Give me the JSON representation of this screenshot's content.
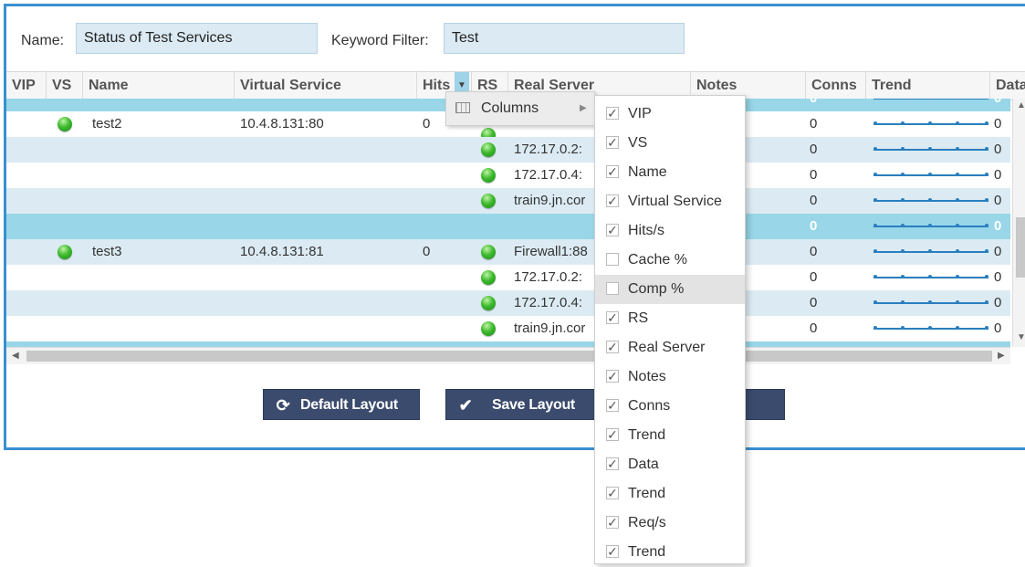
{
  "filter": {
    "name_label": "Name:",
    "name_value": "Status of Test Services",
    "keyword_label": "Keyword Filter:",
    "keyword_value": "Test"
  },
  "columns": [
    "VIP",
    "VS",
    "Name",
    "Virtual Service",
    "Hits",
    "RS",
    "Real Server",
    "Notes",
    "Conns",
    "Trend",
    "Data"
  ],
  "rows": [
    {
      "name": "",
      "vs": "",
      "hits": "",
      "rs": "",
      "real_server": "",
      "conns": "0",
      "data": "0"
    },
    {
      "name": "test2",
      "vs": "10.4.8.131:80",
      "hits": "0",
      "rs": "",
      "real_server": "",
      "conns": "0",
      "data": "0"
    },
    {
      "name": "",
      "vs": "",
      "hits": "",
      "rs": "",
      "real_server": "172.17.0.2:",
      "conns": "0",
      "data": "0"
    },
    {
      "name": "",
      "vs": "",
      "hits": "",
      "rs": "",
      "real_server": "172.17.0.4:",
      "conns": "0",
      "data": "0"
    },
    {
      "name": "",
      "vs": "",
      "hits": "",
      "rs": "",
      "real_server": "train9.jn.cor",
      "conns": "0",
      "data": "0"
    },
    {
      "name": "",
      "vs": "",
      "hits": "",
      "rs": "",
      "real_server": "",
      "conns": "0",
      "data": "0"
    },
    {
      "name": "test3",
      "vs": "10.4.8.131:81",
      "hits": "0",
      "rs": "",
      "real_server": "Firewall1:88",
      "conns": "0",
      "data": "0"
    },
    {
      "name": "",
      "vs": "",
      "hits": "",
      "rs": "",
      "real_server": "172.17.0.2:",
      "conns": "0",
      "data": "0"
    },
    {
      "name": "",
      "vs": "",
      "hits": "",
      "rs": "",
      "real_server": "172.17.0.4:",
      "conns": "0",
      "data": "0"
    },
    {
      "name": "",
      "vs": "",
      "hits": "",
      "rs": "",
      "real_server": "train9.jn.cor",
      "conns": "0",
      "data": "0"
    }
  ],
  "column_menu": {
    "label": "Columns",
    "items": [
      {
        "label": "VIP",
        "checked": true
      },
      {
        "label": "VS",
        "checked": true
      },
      {
        "label": "Name",
        "checked": true
      },
      {
        "label": "Virtual Service",
        "checked": true
      },
      {
        "label": "Hits/s",
        "checked": true
      },
      {
        "label": "Cache %",
        "checked": false
      },
      {
        "label": "Comp %",
        "checked": false
      },
      {
        "label": "RS",
        "checked": true
      },
      {
        "label": "Real Server",
        "checked": true
      },
      {
        "label": "Notes",
        "checked": true
      },
      {
        "label": "Conns",
        "checked": true
      },
      {
        "label": "Trend",
        "checked": true
      },
      {
        "label": "Data",
        "checked": true
      },
      {
        "label": "Trend",
        "checked": true
      },
      {
        "label": "Req/s",
        "checked": true
      },
      {
        "label": "Trend",
        "checked": true
      }
    ]
  },
  "buttons": {
    "default_layout": "Default Layout",
    "save_layout": "Save Layout"
  },
  "colors": {
    "accent": "#3a8fd0",
    "button": "#3b4b6d",
    "row_alt": "#dcebf3",
    "row_selected": "#98d6e8",
    "status_ok": "#3fbb2e"
  }
}
